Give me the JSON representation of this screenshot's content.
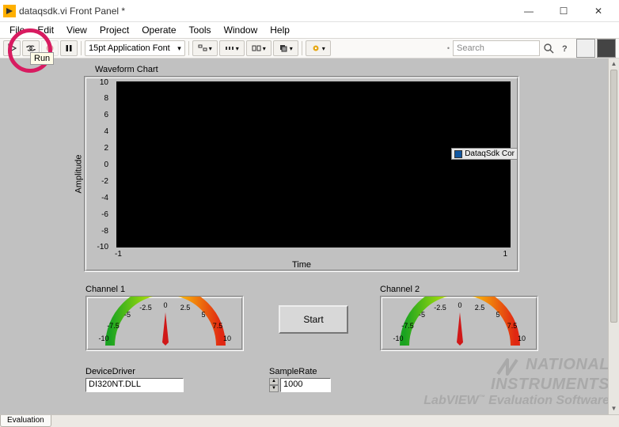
{
  "title": "dataqsdk.vi Front Panel *",
  "menu": [
    "File",
    "Edit",
    "View",
    "Project",
    "Operate",
    "Tools",
    "Window",
    "Help"
  ],
  "toolbar": {
    "font": "15pt Application Font"
  },
  "search": {
    "placeholder": "Search"
  },
  "tooltip": {
    "run": "Run"
  },
  "chart": {
    "title": "Waveform Chart",
    "ylabel": "Amplitude",
    "xlabel": "Time",
    "yticks": [
      10,
      8,
      6,
      4,
      2,
      0,
      -2,
      -4,
      -6,
      -8,
      -10
    ],
    "xticks": {
      "min": "-1",
      "max": "1"
    },
    "legend": "DataqSdk Cor"
  },
  "chart_data": {
    "type": "line",
    "title": "Waveform Chart",
    "xlabel": "Time",
    "ylabel": "Amplitude",
    "xlim": [
      -1,
      1
    ],
    "ylim": [
      -10,
      10
    ],
    "series": [
      {
        "name": "DataqSdk Cor",
        "x": [],
        "y": []
      }
    ]
  },
  "gauges": {
    "ch1": {
      "label": "Channel 1",
      "ticks": [
        "-10",
        "-7.5",
        "-5",
        "-2.5",
        "0",
        "2.5",
        "5",
        "7.5",
        "10"
      ],
      "value": 0
    },
    "ch2": {
      "label": "Channel 2",
      "ticks": [
        "-10",
        "-7.5",
        "-5",
        "-2.5",
        "0",
        "2.5",
        "5",
        "7.5",
        "10"
      ],
      "value": 0
    }
  },
  "buttons": {
    "start": "Start"
  },
  "controls": {
    "device_label": "DeviceDriver",
    "device_value": "DI320NT.DLL",
    "rate_label": "SampleRate",
    "rate_value": "1000"
  },
  "watermark": {
    "line1": "NATIONAL",
    "line2": "INSTRUMENTS",
    "line3a": "LabVIEW",
    "line3b": "Evaluation Software"
  },
  "tabs": {
    "evaluation": "Evaluation"
  }
}
